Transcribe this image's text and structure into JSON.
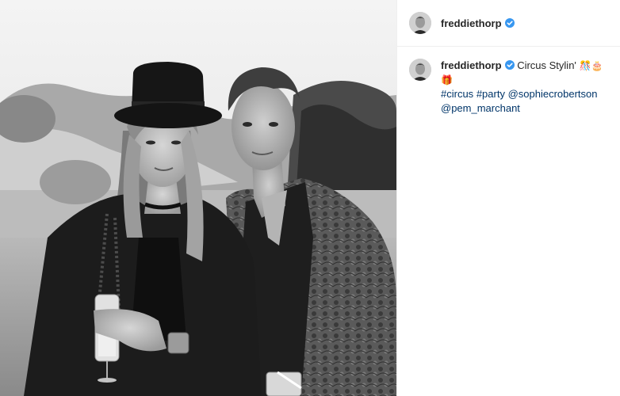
{
  "post": {
    "author": "freddiethorp",
    "verified": true,
    "caption": {
      "text": "Circus Stylin'",
      "emojis": [
        "🎊",
        "🎂",
        "🎁"
      ],
      "hashtags": [
        "#circus",
        "#party"
      ],
      "mentions": [
        "@sophiecrobertson",
        "@pem_marchant"
      ]
    },
    "photo": {
      "style": "black-and-white",
      "icon": "photo-image"
    }
  },
  "colors": {
    "username": "#262626",
    "link": "#003569",
    "verified_badge": "#3897f0",
    "divider": "#efefef"
  }
}
